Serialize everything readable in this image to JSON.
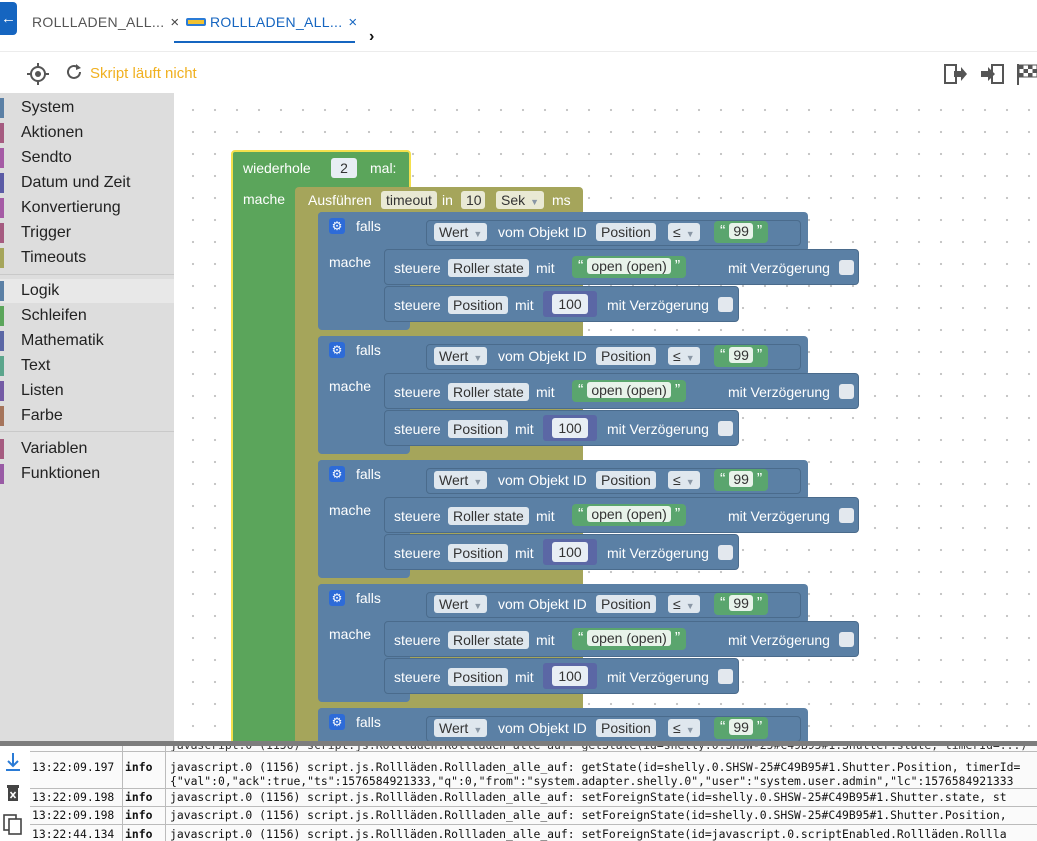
{
  "tabs": [
    {
      "label": "ROLLLADEN_ALL...",
      "close": "×"
    },
    {
      "label": "ROLLLADEN_ALL...",
      "close": "×"
    }
  ],
  "toolbar": {
    "status": "Skript läuft nicht",
    "status_color": "#f0b020"
  },
  "categories": [
    {
      "label": "System",
      "color": "#5b80a5"
    },
    {
      "label": "Aktionen",
      "color": "#a55b80"
    },
    {
      "label": "Sendto",
      "color": "#a55ba5"
    },
    {
      "label": "Datum und Zeit",
      "color": "#5b5ba5"
    },
    {
      "label": "Konvertierung",
      "color": "#a55ba5"
    },
    {
      "label": "Trigger",
      "color": "#a55b80"
    },
    {
      "label": "Timeouts",
      "color": "#a5a55b"
    },
    {
      "label": "Logik",
      "color": "#5b80a5"
    },
    {
      "label": "Schleifen",
      "color": "#5ba55b"
    },
    {
      "label": "Mathematik",
      "color": "#5b67a5"
    },
    {
      "label": "Text",
      "color": "#5ba58c"
    },
    {
      "label": "Listen",
      "color": "#745ba5"
    },
    {
      "label": "Farbe",
      "color": "#a5745b"
    },
    {
      "label": "Variablen",
      "color": "#a55b80"
    },
    {
      "label": "Funktionen",
      "color": "#995ba5"
    }
  ],
  "blocks": {
    "repeat": {
      "label": "wiederhole",
      "times": "2",
      "suffix": "mal:",
      "do": "mache",
      "color": "#5ba55b"
    },
    "timeout": {
      "label": "Ausführen",
      "name": "timeout",
      "in": "in",
      "value": "10",
      "unit": "Sek",
      "ms": "ms",
      "color": "#a5a55b"
    },
    "ifs": [
      {
        "falls": "falls",
        "wert": "Wert",
        "vom": "vom Objekt ID",
        "id": "Position",
        "op": "≤",
        "cmp": "99",
        "mache": "mache",
        "s1": "steuere",
        "s1_obj": "Roller state",
        "s1_mit": "mit",
        "s1_val": "open (open)",
        "s1_delay": "mit Verzögerung",
        "s2": "steuere",
        "s2_obj": "Position",
        "s2_mit": "mit",
        "s2_val": "100",
        "s2_delay": "mit Verzögerung"
      },
      {
        "falls": "falls",
        "wert": "Wert",
        "vom": "vom Objekt ID",
        "id": "Position",
        "op": "≤",
        "cmp": "99",
        "mache": "mache",
        "s1": "steuere",
        "s1_obj": "Roller state",
        "s1_mit": "mit",
        "s1_val": "open (open)",
        "s1_delay": "mit Verzögerung",
        "s2": "steuere",
        "s2_obj": "Position",
        "s2_mit": "mit",
        "s2_val": "100",
        "s2_delay": "mit Verzögerung"
      },
      {
        "falls": "falls",
        "wert": "Wert",
        "vom": "vom Objekt ID",
        "id": "Position",
        "op": "≤",
        "cmp": "99",
        "mache": "mache",
        "s1": "steuere",
        "s1_obj": "Roller state",
        "s1_mit": "mit",
        "s1_val": "open (open)",
        "s1_delay": "mit Verzögerung",
        "s2": "steuere",
        "s2_obj": "Position",
        "s2_mit": "mit",
        "s2_val": "100",
        "s2_delay": "mit Verzögerung"
      },
      {
        "falls": "falls",
        "wert": "Wert",
        "vom": "vom Objekt ID",
        "id": "Position",
        "op": "≤",
        "cmp": "99",
        "mache": "mache",
        "s1": "steuere",
        "s1_obj": "Roller state",
        "s1_mit": "mit",
        "s1_val": "open (open)",
        "s1_delay": "mit Verzögerung",
        "s2": "steuere",
        "s2_obj": "Position",
        "s2_mit": "mit",
        "s2_val": "100",
        "s2_delay": "mit Verzögerung"
      },
      {
        "falls": "falls",
        "wert": "Wert",
        "vom": "vom Objekt ID",
        "id": "Position",
        "op": "≤",
        "cmp": "99"
      }
    ]
  },
  "log": [
    {
      "ts": "13:22:09.197",
      "level": "info",
      "msg": "javascript.0 (1156) script.js.Rollläden.Rollladen_alle_auf: getState(id=shelly.0.SHSW-25#C49B95#1.Shutter.Position, timerId=",
      "msg2": "{\"val\":0,\"ack\":true,\"ts\":1576584921333,\"q\":0,\"from\":\"system.adapter.shelly.0\",\"user\":\"system.user.admin\",\"lc\":1576584921333"
    },
    {
      "ts": "13:22:09.198",
      "level": "info",
      "msg": "javascript.0 (1156) script.js.Rollläden.Rollladen_alle_auf: setForeignState(id=shelly.0.SHSW-25#C49B95#1.Shutter.state, st"
    },
    {
      "ts": "13:22:09.198",
      "level": "info",
      "msg": "javascript.0 (1156) script.js.Rollläden.Rollladen_alle_auf: setForeignState(id=shelly.0.SHSW-25#C49B95#1.Shutter.Position,"
    },
    {
      "ts": "13:22:44.134",
      "level": "info",
      "msg": "javascript.0 (1156) script.js.Rollläden.Rollladen_alle_auf: setForeignState(id=javascript.0.scriptEnabled.Rollläden.Rollla"
    }
  ]
}
